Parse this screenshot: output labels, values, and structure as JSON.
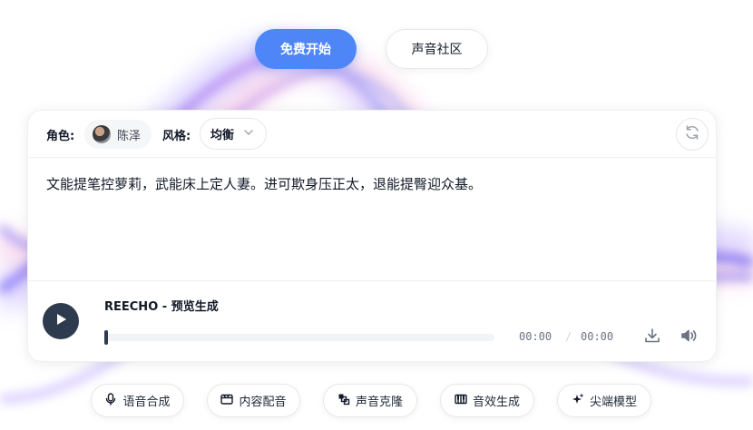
{
  "top_buttons": {
    "primary_label": "免费开始",
    "secondary_label": "声音社区"
  },
  "card": {
    "role_label": "角色:",
    "role_value": "陈泽",
    "style_label": "风格:",
    "style_value": "均衡",
    "text": "文能提笔控萝莉，武能床上定人妻。进可欺身压正太，退能提臀迎众基。"
  },
  "player": {
    "title": "REECHO - 预览生成",
    "current_time": "00:00",
    "separator": "/",
    "duration": "00:00",
    "progress": 0
  },
  "features": [
    {
      "label": "语音合成",
      "icon": "microphone-icon"
    },
    {
      "label": "内容配音",
      "icon": "clapperboard-icon"
    },
    {
      "label": "声音克隆",
      "icon": "clone-icon"
    },
    {
      "label": "音效生成",
      "icon": "piano-icon"
    },
    {
      "label": "尖端模型",
      "icon": "sparkles-icon"
    }
  ],
  "colors": {
    "primary": "#4f86f7",
    "play_button": "#2e3a4d"
  }
}
